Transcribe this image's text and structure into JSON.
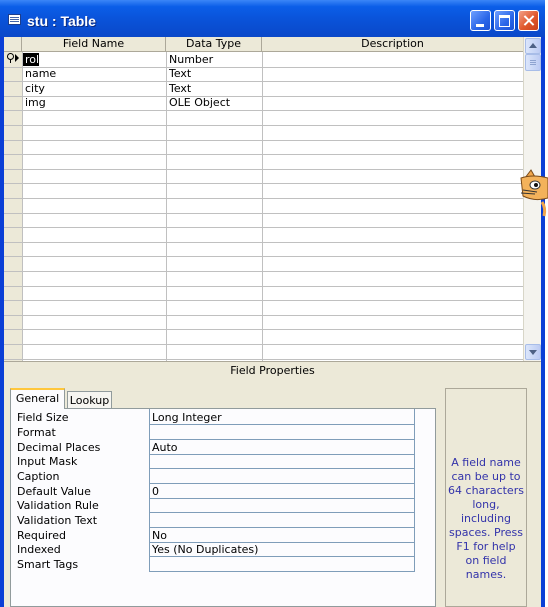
{
  "window": {
    "title": "stu : Table"
  },
  "grid": {
    "columns": [
      "Field Name",
      "Data Type",
      "Description"
    ],
    "rows": [
      {
        "field": "roll",
        "type": "Number",
        "description": ""
      },
      {
        "field": "name",
        "type": "Text",
        "description": ""
      },
      {
        "field": "city",
        "type": "Text",
        "description": ""
      },
      {
        "field": "img",
        "type": "OLE Object",
        "description": ""
      }
    ]
  },
  "field_properties": {
    "label": "Field Properties",
    "tabs": [
      "General",
      "Lookup"
    ],
    "properties": [
      {
        "label": "Field Size",
        "value": "Long Integer"
      },
      {
        "label": "Format",
        "value": ""
      },
      {
        "label": "Decimal Places",
        "value": "Auto"
      },
      {
        "label": "Input Mask",
        "value": ""
      },
      {
        "label": "Caption",
        "value": ""
      },
      {
        "label": "Default Value",
        "value": "0"
      },
      {
        "label": "Validation Rule",
        "value": ""
      },
      {
        "label": "Validation Text",
        "value": ""
      },
      {
        "label": "Required",
        "value": "No"
      },
      {
        "label": "Indexed",
        "value": "Yes (No Duplicates)"
      },
      {
        "label": "Smart Tags",
        "value": ""
      }
    ],
    "help_text": "A field name can be up to 64 characters long, including spaces.  Press F1 for help on field names."
  }
}
